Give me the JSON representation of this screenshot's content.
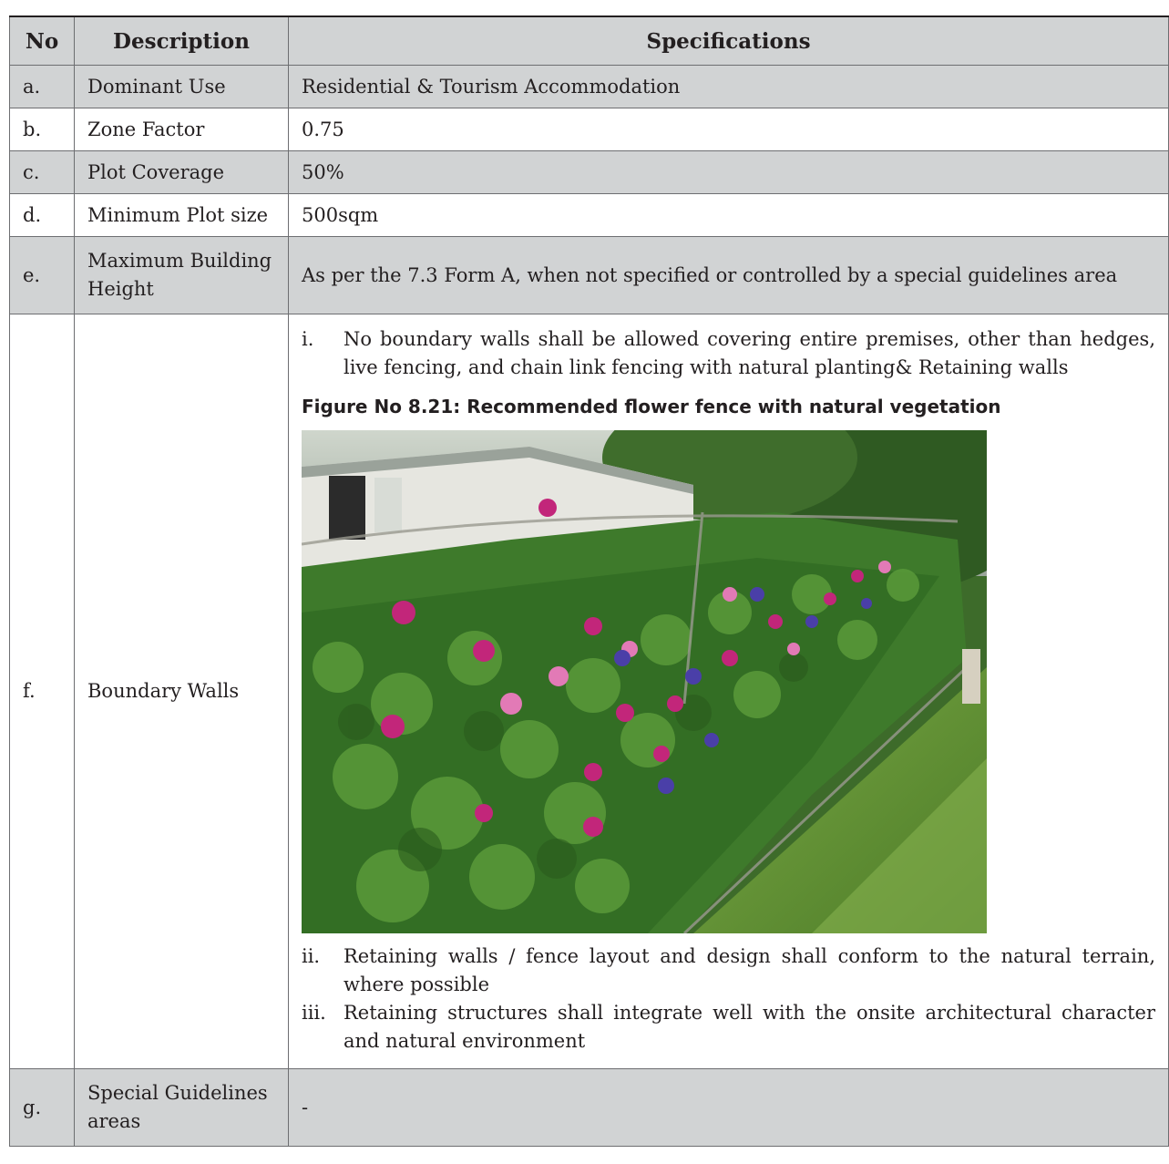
{
  "headers": {
    "no": "No",
    "description": "Description",
    "specifications": "Specifications"
  },
  "rows": {
    "a": {
      "no": "a.",
      "description": "Dominant Use",
      "spec": "Residential & Tourism Accommodation"
    },
    "b": {
      "no": "b.",
      "description": "Zone Factor",
      "spec": "0.75"
    },
    "c": {
      "no": "c.",
      "description": "Plot Coverage",
      "spec": "50%"
    },
    "d": {
      "no": "d.",
      "description": "Minimum Plot size",
      "spec": "500sqm"
    },
    "e": {
      "no": "e.",
      "description": "Maximum Building Height",
      "spec": "As per the 7.3 Form A, when not specified or controlled by a special guidelines area"
    },
    "f": {
      "no": "f.",
      "description": "Boundary Walls",
      "item1_num": "i.",
      "item1_text": "No boundary walls shall be allowed covering entire premises, other than hedges, live fencing, and chain link fencing with natural planting& Retaining walls",
      "figure_caption": "Figure No 8.21: Recommended flower fence with natural vegetation",
      "item2_num": "ii.",
      "item2_text": "Retaining walls / fence layout and design shall conform to the natural terrain, where possible",
      "item3_num": "iii.",
      "item3_text": "Retaining structures shall integrate well with the onsite architectural character and natural environment"
    },
    "g": {
      "no": "g.",
      "description": "Special Guidelines areas",
      "spec": "-"
    }
  },
  "colors": {
    "header_bg": "#d1d3d4",
    "stripe_bg": "#d1d3d4",
    "border": "#6d6e71"
  }
}
